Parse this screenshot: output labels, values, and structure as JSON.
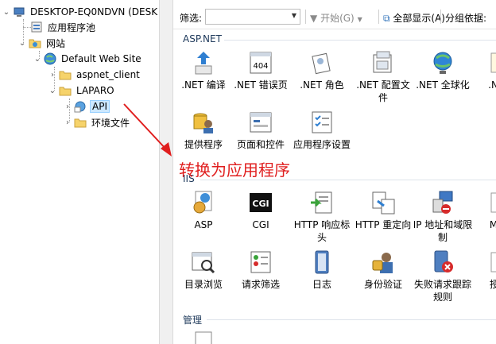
{
  "tree": {
    "server": "DESKTOP-EQ0NDVN (DESK",
    "app_pools": "应用程序池",
    "sites": "网站",
    "default_site": "Default Web Site",
    "aspnet_client": "aspnet_client",
    "laparo": "LAPARO",
    "api": "API",
    "env_files": "环境文件"
  },
  "toolbar": {
    "filter_label": "筛选:",
    "start_label": "开始(G)",
    "show_all_label": "全部显示(A)",
    "group_label": "分组依据:"
  },
  "sections": {
    "aspnet": "ASP.NET",
    "iis": "IIS",
    "manage": "管理"
  },
  "aspnet_features": [
    ".NET 编译",
    ".NET 错误页",
    ".NET 角色",
    ".NET 配置文件",
    ".NET 全球化",
    ".NET",
    "提供程序",
    "页面和控件",
    "应用程序设置"
  ],
  "iis_features": [
    "ASP",
    "CGI",
    "HTTP 响应标头",
    "HTTP 重定向",
    "IP 地址和域限制",
    "MIM",
    "目录浏览",
    "请求筛选",
    "日志",
    "身份验证",
    "失败请求跟踪规则",
    "授权"
  ],
  "cgi_badge": "CGI",
  "error_badge": "404",
  "annotation": "转换为应用程序",
  "colors": {
    "annotation": "#e01e1e",
    "selection": "#cce8ff",
    "section_header": "#1e395b"
  }
}
